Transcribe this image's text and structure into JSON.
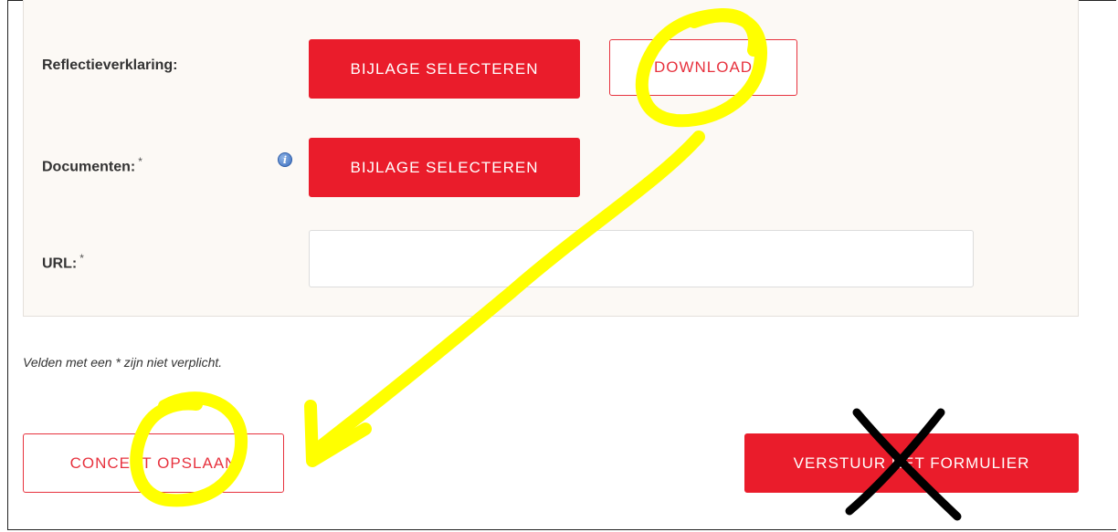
{
  "form": {
    "reflectie": {
      "label": "Reflectieverklaring:",
      "select_button": "BIJLAGE SELECTEREN",
      "download_button": "DOWNLOAD"
    },
    "documenten": {
      "label": "Documenten:",
      "required_mark": "*",
      "info_icon": "i",
      "select_button": "BIJLAGE SELECTEREN"
    },
    "url": {
      "label": "URL:",
      "required_mark": "*",
      "value": ""
    },
    "note": "Velden met een * zijn niet verplicht.",
    "save_draft_button": "CONCEPT OPSLAAN",
    "submit_button": "VERSTUUR HET FORMULIER"
  },
  "colors": {
    "primary_red": "#ea1c2b",
    "panel_bg": "#fcf9f5",
    "annotation_yellow": "#ffff00",
    "annotation_black": "#000000"
  },
  "annotations": {
    "icons": [
      "yellow-circle-icon",
      "yellow-arrow-icon",
      "black-cross-icon"
    ]
  }
}
